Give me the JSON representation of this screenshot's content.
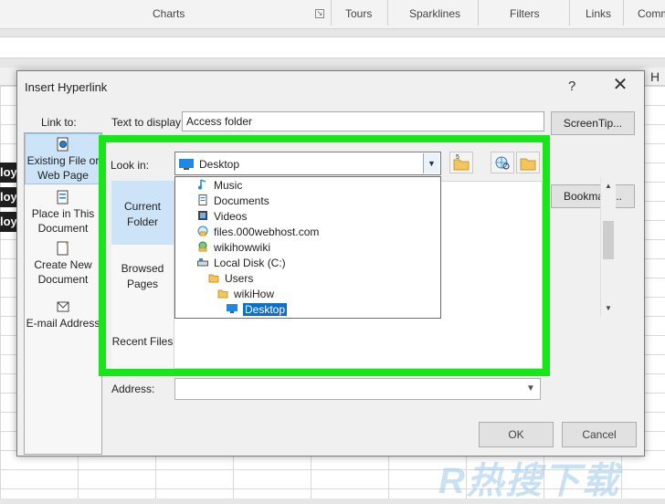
{
  "ribbon": {
    "groups": [
      "Charts",
      "Tours",
      "Sparklines",
      "Filters",
      "Links",
      "Comm"
    ]
  },
  "sheet": {
    "col_h": "H",
    "dark_cells": [
      "loy",
      "loy",
      "loy"
    ]
  },
  "dialog": {
    "title": "Insert Hyperlink",
    "help": "?",
    "close": "✕",
    "link_to_label": "Link to:",
    "link_to_items": [
      "Existing File or Web Page",
      "Place in This Document",
      "Create New Document",
      "E-mail Address"
    ],
    "text_to_display_label": "Text to display:",
    "text_to_display_value": "Access folder",
    "screentip_label": "ScreenTip...",
    "bookmark_label": "Bookmark...",
    "look_in_label": "Look in:",
    "look_in_value": "Desktop",
    "places": [
      "Current Folder",
      "Browsed Pages",
      "Recent Files"
    ],
    "dropdown_items": [
      {
        "label": "Music",
        "icon": "music-icon"
      },
      {
        "label": "Documents",
        "icon": "documents-icon"
      },
      {
        "label": "Videos",
        "icon": "videos-icon"
      },
      {
        "label": "files.000webhost.com",
        "icon": "ftp-icon"
      },
      {
        "label": "wikihowwiki",
        "icon": "network-icon"
      },
      {
        "label": "Local Disk (C:)",
        "icon": "drive-icon"
      },
      {
        "label": "Users",
        "icon": "folder-icon"
      },
      {
        "label": "wikiHow",
        "icon": "folder-icon"
      },
      {
        "label": "Desktop",
        "icon": "desktop-icon"
      }
    ],
    "address_label": "Address:",
    "ok_label": "OK",
    "cancel_label": "Cancel"
  },
  "watermark": "R热搜下载",
  "colors": {
    "highlight": "#19e619",
    "selection": "#0f6fc6"
  }
}
